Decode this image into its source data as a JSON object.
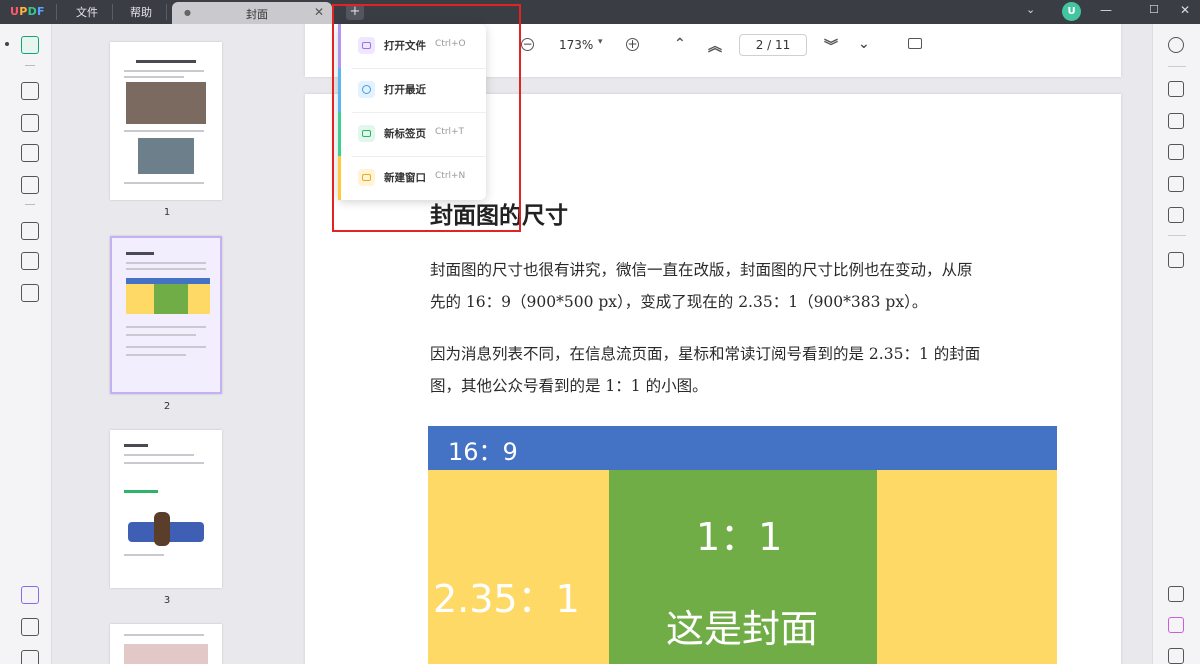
{
  "app": {
    "logo": [
      "U",
      "P",
      "D",
      "F"
    ]
  },
  "menubar": {
    "file": "文件",
    "help": "帮助"
  },
  "tab": {
    "title": "封面"
  },
  "user": {
    "initial": "U"
  },
  "toolbar": {
    "zoom": "173%",
    "page_indicator": "2 / 11"
  },
  "thumbnails": {
    "pages": [
      "1",
      "2",
      "3"
    ]
  },
  "dropdown": {
    "items": [
      {
        "label": "打开文件",
        "shortcut": "Ctrl+O",
        "color": "#b594f0"
      },
      {
        "label": "打开最近",
        "shortcut": "",
        "color": "#5ab6f0"
      },
      {
        "label": "新标签页",
        "shortcut": "Ctrl+T",
        "color": "#3fcf8e"
      },
      {
        "label": "新建窗口",
        "shortcut": "Ctrl+N",
        "color": "#ffc83d"
      }
    ]
  },
  "document": {
    "heading": "封面图的尺寸",
    "paragraph1_line1": "封面图的尺寸也很有讲究，微信一直在改版，封面图的尺寸比例也在变动，从原",
    "paragraph1_line2": "先的 16：9（900*500 px），变成了现在的 2.35：1（900*383 px）。",
    "paragraph2_line1": "因为消息列表不同，在信息流页面，星标和常读订阅号看到的是 2.35：1 的封面",
    "paragraph2_line2": "图，其他公众号看到的是 1：1 的小图。",
    "figure": {
      "ratio_169": "16：9",
      "ratio_235": "2.35：1",
      "ratio_11": "1：1",
      "cover_label": "这是封面"
    }
  },
  "colors": {
    "accent": "#17a37a",
    "highlight": "#e02424",
    "figure_blue": "#4472c4",
    "figure_yellow": "#ffd966",
    "figure_green": "#70ad47"
  }
}
